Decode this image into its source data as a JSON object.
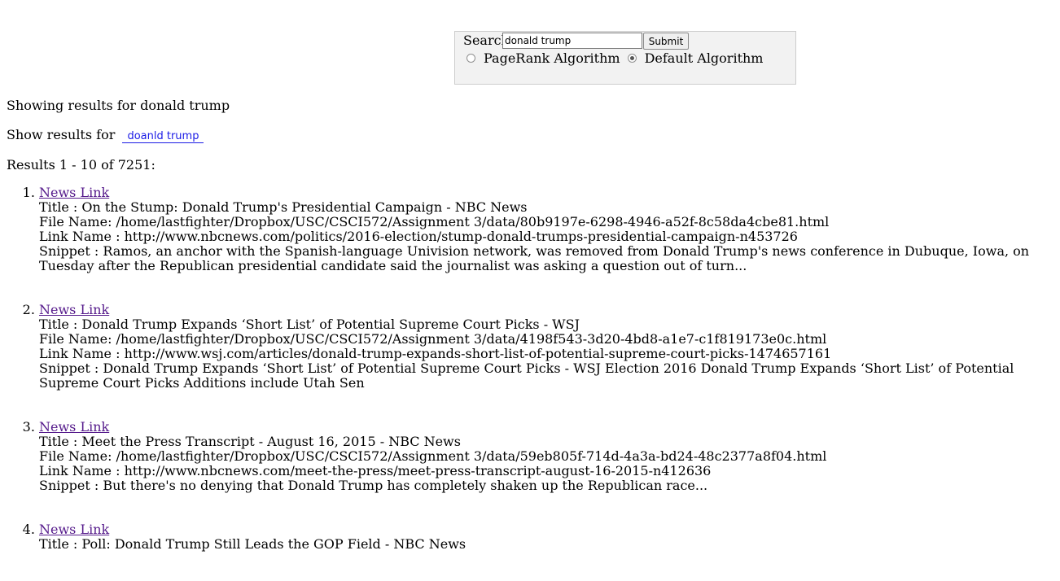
{
  "search": {
    "label": "Search:",
    "value": "donald trump",
    "submit_label": "Submit"
  },
  "algorithms": {
    "options": [
      {
        "label": "PageRank Algorithm",
        "selected": false
      },
      {
        "label": "Default Algorithm",
        "selected": true
      }
    ]
  },
  "status": {
    "showing_results": "Showing results for donald trump",
    "show_results_for_label": "Show results for",
    "suggestion": "doanld trump",
    "results_count": "Results 1 - 10 of 7251:"
  },
  "results": [
    {
      "link_text": "News Link ",
      "title": "Title : On the Stump: Donald Trump's Presidential Campaign - NBC News",
      "file_name": "File Name: /home/lastfighter/Dropbox/USC/CSCI572/Assignment 3/data/80b9197e-6298-4946-a52f-8c58da4cbe81.html",
      "link_name": "Link Name : http://www.nbcnews.com/politics/2016-election/stump-donald-trumps-presidential-campaign-n453726",
      "snippet": "Snippet : Ramos, an anchor with the Spanish-language Univision network, was removed from Donald Trump's news conference in Dubuque, Iowa, on Tuesday after the Republican presidential candidate said the journalist was asking a question out of turn..."
    },
    {
      "link_text": "News Link ",
      "title": "Title : Donald Trump Expands ‘Short List’ of Potential Supreme Court Picks - WSJ",
      "file_name": "File Name: /home/lastfighter/Dropbox/USC/CSCI572/Assignment 3/data/4198f543-3d20-4bd8-a1e7-c1f819173e0c.html",
      "link_name": "Link Name : http://www.wsj.com/articles/donald-trump-expands-short-list-of-potential-supreme-court-picks-1474657161",
      "snippet": "Snippet : Donald Trump Expands ‘Short List’ of Potential Supreme Court Picks - WSJ Election 2016 Donald Trump Expands ‘Short List’ of Potential Supreme Court Picks Additions include Utah Sen"
    },
    {
      "link_text": "News Link ",
      "title": "Title : Meet the Press Transcript - August 16, 2015 - NBC News",
      "file_name": "File Name: /home/lastfighter/Dropbox/USC/CSCI572/Assignment 3/data/59eb805f-714d-4a3a-bd24-48c2377a8f04.html",
      "link_name": "Link Name : http://www.nbcnews.com/meet-the-press/meet-press-transcript-august-16-2015-n412636",
      "snippet": "Snippet : But there's no denying that Donald Trump has completely shaken up the Republican race..."
    },
    {
      "link_text": "News Link ",
      "title": "Title : Poll: Donald Trump Still Leads the GOP Field - NBC News"
    }
  ]
}
